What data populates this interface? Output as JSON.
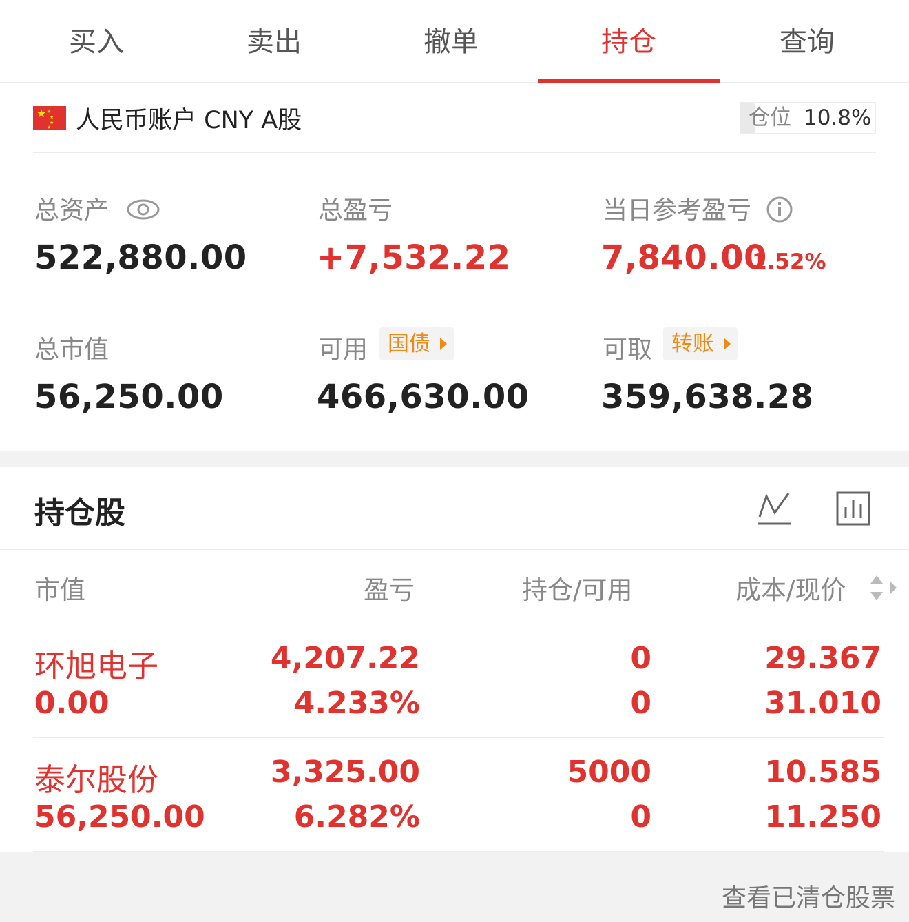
{
  "tabs": [
    {
      "label": "买入"
    },
    {
      "label": "卖出"
    },
    {
      "label": "撤单"
    },
    {
      "label": "持仓",
      "active": true
    },
    {
      "label": "查询"
    }
  ],
  "account": {
    "label": "人民币账户 CNY A股",
    "position_label": "仓位",
    "position_value": "10.8%",
    "position_fraction": 0.108
  },
  "metrics": {
    "total_assets_label": "总资产",
    "total_assets_value": "522,880.00",
    "total_pl_label": "总盈亏",
    "total_pl_value": "+7,532.22",
    "daily_pl_label": "当日参考盈亏",
    "daily_pl_value": "7,840.00",
    "daily_pl_pct": "1.52%",
    "market_value_label": "总市值",
    "market_value_value": "56,250.00",
    "available_label": "可用",
    "available_chip": "国债",
    "available_value": "466,630.00",
    "withdrawable_label": "可取",
    "withdrawable_chip": "转账",
    "withdrawable_value": "359,638.28"
  },
  "holdings": {
    "title": "持仓股",
    "columns": [
      "市值",
      "盈亏",
      "持仓/可用",
      "成本/现价"
    ],
    "rows": [
      {
        "name": "环旭电子",
        "market_value": "0.00",
        "pl": "4,207.22",
        "pl_pct": "4.233%",
        "position": "0",
        "available": "0",
        "cost": "29.367",
        "price": "31.010"
      },
      {
        "name": "泰尔股份",
        "market_value": "56,250.00",
        "pl": "3,325.00",
        "pl_pct": "6.282%",
        "position": "5000",
        "available": "0",
        "cost": "10.585",
        "price": "11.250"
      }
    ]
  },
  "footer": {
    "text": "查看已清仓股票"
  },
  "colors": {
    "accent": "#e0322f",
    "chip_text": "#f08a14"
  }
}
